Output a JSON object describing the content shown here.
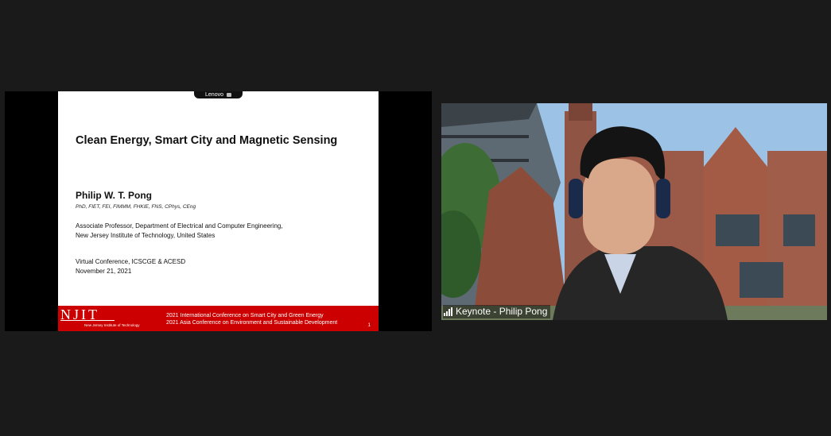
{
  "slide": {
    "lenovo_label": "Lenovo",
    "title": "Clean Energy, Smart City and Magnetic Sensing",
    "presenter": "Philip W. T. Pong",
    "credentials": "PhD, FIET, FEI, FIMMM, FHKIE, FNS, CPhys, CEng",
    "affiliation_line1": "Associate Professor, Department of Electrical and Computer Engineering,",
    "affiliation_line2": "New Jersey Institute of Technology, United States",
    "conference": "Virtual Conference, ICSCGE & ACESD",
    "date": "November 21, 2021",
    "footer": {
      "logo_text": "NJIT",
      "logo_subtext": "New Jersey Institute of Technology",
      "conference_line1": "2021 International Conference on Smart City and Green Energy",
      "conference_line2": "2021 Asia Conference on Environment and Sustainable Development",
      "slide_number": "1"
    }
  },
  "video": {
    "participant_name": "Keynote - Philip Pong",
    "signal_icon": "signal-strength-icon"
  },
  "colors": {
    "background": "#1a1a1a",
    "footer_red": "#cc0000",
    "brick": "#9a4f3c"
  }
}
